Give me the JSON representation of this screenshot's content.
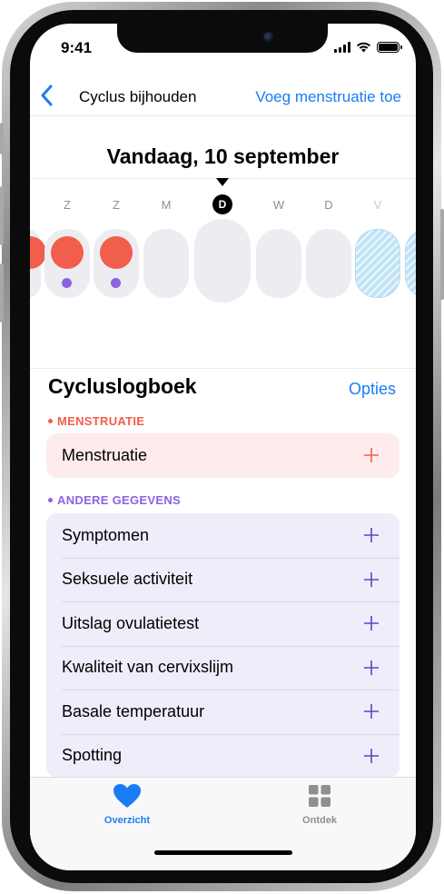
{
  "status_bar": {
    "time": "9:41"
  },
  "nav": {
    "title": "Cyclus bijhouden",
    "action": "Voeg menstruatie toe"
  },
  "calendar": {
    "date_title": "Vandaag, 10 september",
    "day_labels": [
      "Z",
      "Z",
      "M",
      "D",
      "W",
      "D",
      "V"
    ],
    "today_label": "D"
  },
  "log": {
    "title": "Cycluslogboek",
    "options_label": "Opties",
    "menstruation_section": "MENSTRUATIE",
    "menstruation_rows": [
      {
        "label": "Menstruatie"
      }
    ],
    "other_section": "ANDERE GEGEVENS",
    "other_rows": [
      {
        "label": "Symptomen"
      },
      {
        "label": "Seksuele activiteit"
      },
      {
        "label": "Uitslag ovulatietest"
      },
      {
        "label": "Kwaliteit van cervixslijm"
      },
      {
        "label": "Basale temperatuur"
      },
      {
        "label": "Spotting"
      }
    ]
  },
  "tabs": [
    {
      "label": "Overzicht",
      "icon": "heart-icon",
      "active": true
    },
    {
      "label": "Ontdek",
      "icon": "grid-icon",
      "active": false
    }
  ],
  "colors": {
    "accent": "#1a7cf5",
    "period": "#f15e4b",
    "other_data": "#8c63df",
    "period_card": "#fdeceb",
    "other_card": "#efedfa",
    "predicted": "#bfe3f6"
  }
}
